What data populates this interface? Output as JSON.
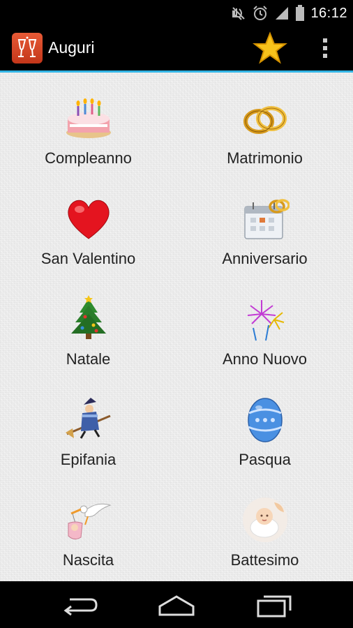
{
  "status_bar": {
    "time": "16:12",
    "icons": [
      "muted-icon",
      "alarm-icon",
      "signal-icon",
      "battery-icon"
    ]
  },
  "action_bar": {
    "title": "Auguri",
    "accent_color": "#33b5e5",
    "icons": [
      "app-logo-icon",
      "star-icon",
      "overflow-menu-icon"
    ]
  },
  "categories": [
    {
      "label": "Compleanno",
      "icon": "birthday-cake-icon"
    },
    {
      "label": "Matrimonio",
      "icon": "wedding-rings-icon"
    },
    {
      "label": "San Valentino",
      "icon": "heart-icon"
    },
    {
      "label": "Anniversario",
      "icon": "calendar-rings-icon"
    },
    {
      "label": "Natale",
      "icon": "christmas-tree-icon"
    },
    {
      "label": "Anno Nuovo",
      "icon": "fireworks-icon"
    },
    {
      "label": "Epifania",
      "icon": "witch-broom-icon"
    },
    {
      "label": "Pasqua",
      "icon": "easter-egg-icon"
    },
    {
      "label": "Nascita",
      "icon": "stork-baby-icon"
    },
    {
      "label": "Battesimo",
      "icon": "baby-icon"
    }
  ],
  "nav_bar": {
    "icons": [
      "back-icon",
      "home-icon",
      "recent-apps-icon"
    ]
  }
}
